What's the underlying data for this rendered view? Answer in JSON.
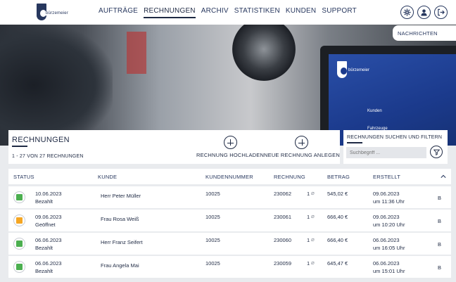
{
  "header": {
    "logo_text": "bürzemeier",
    "nav": [
      {
        "label": "AUFTRÄGE",
        "active": false
      },
      {
        "label": "RECHNUNGEN",
        "active": true
      },
      {
        "label": "ARCHIV",
        "active": false
      },
      {
        "label": "STATISTIKEN",
        "active": false
      },
      {
        "label": "KUNDEN",
        "active": false
      },
      {
        "label": "SUPPORT",
        "active": false
      }
    ],
    "icons": [
      "gear-icon",
      "user-icon",
      "logout-icon"
    ]
  },
  "hero": {
    "screen_logo": "bürzemeier",
    "screen_rows": [
      "Kunden",
      "Fahrzeuge"
    ]
  },
  "messages_tab": "NACHRICHTEN",
  "invoices_panel": {
    "title": "RECHNUNGEN",
    "count": "1 - 27 VON 27 RECHNUNGEN",
    "upload_label": "RECHNUNG HOCHLADEN",
    "create_label": "NEUE RECHNUNG ANLEGEN"
  },
  "search_panel": {
    "title": "RECHNUNGEN SUCHEN UND FILTERN",
    "placeholder": "Suchbegriff ..."
  },
  "table": {
    "columns": [
      "STATUS",
      "KUNDE",
      "KUNDENNUMMER",
      "RECHNUNG",
      "BETRAG",
      "ERSTELLT"
    ],
    "rows": [
      {
        "date": "10.06.2023",
        "status": "Bezahlt",
        "status_color": "#4caf50",
        "customer": "Herr Peter Müller",
        "customer_no": "10025",
        "invoice": "230062",
        "attachments": "1",
        "amount": "545,02 €",
        "created_date": "09.06.2023",
        "created_time": "um 11:36 Uhr",
        "action": "B"
      },
      {
        "date": "09.06.2023",
        "status": "Geöffnet",
        "status_color": "#f5a623",
        "customer": "Frau Rosa Weiß",
        "customer_no": "10025",
        "invoice": "230061",
        "attachments": "1",
        "amount": "666,40 €",
        "created_date": "09.06.2023",
        "created_time": "um 10:20 Uhr",
        "action": "B"
      },
      {
        "date": "06.06.2023",
        "status": "Bezahlt",
        "status_color": "#4caf50",
        "customer": "Herr Franz Seifert",
        "customer_no": "10025",
        "invoice": "230060",
        "attachments": "1",
        "amount": "666,40 €",
        "created_date": "06.06.2023",
        "created_time": "um 16:05 Uhr",
        "action": "B"
      },
      {
        "date": "06.06.2023",
        "status": "Bezahlt",
        "status_color": "#4caf50",
        "customer": "Frau Angela Mai",
        "customer_no": "10025",
        "invoice": "230059",
        "attachments": "1",
        "amount": "645,47 €",
        "created_date": "06.06.2023",
        "created_time": "um 15:01 Uhr",
        "action": "B"
      }
    ]
  }
}
